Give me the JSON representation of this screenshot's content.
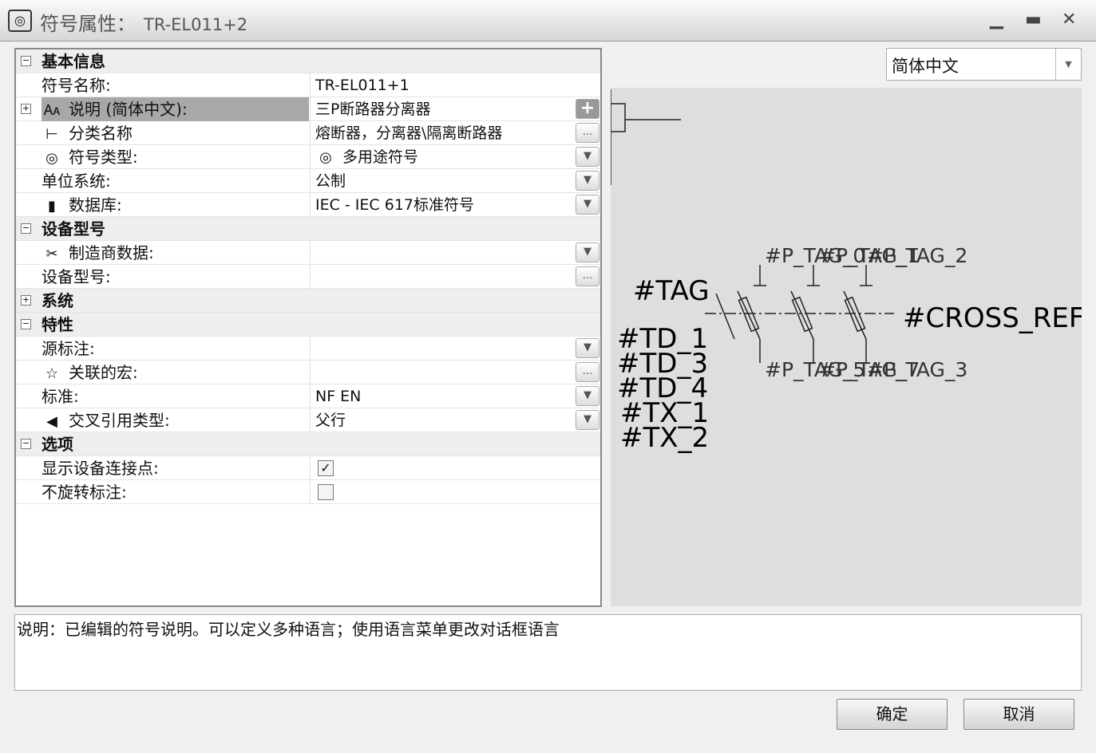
{
  "window": {
    "title": "符号属性：",
    "symbol_id": "TR-EL011+2",
    "icon": "symbol-icon",
    "minimize": "▁",
    "maximize": "▬",
    "close": "✕"
  },
  "grid": {
    "rows": [
      {
        "type": "section",
        "expanded": true,
        "label": "基本信息"
      },
      {
        "label": "符号名称:",
        "value": "TR-EL011+1"
      },
      {
        "label": "说明 (简体中文):",
        "value": "三P断路器分离器",
        "icon": "translate-icon",
        "expander": "+",
        "button": "plus",
        "selected": true
      },
      {
        "label": "分类名称",
        "value": "熔断器，分离器\\隔离断路器",
        "icon": "tree-icon",
        "button": "ellipsis"
      },
      {
        "label": "符号类型:",
        "value": "多用途符号",
        "icon": "symbol-icon",
        "value_icon": "symbol-icon",
        "button": "dropdown"
      },
      {
        "label": "单位系统:",
        "value": "公制",
        "button": "dropdown"
      },
      {
        "label": "数据库:",
        "value": "IEC - IEC 617标准符号",
        "icon": "database-icon",
        "button": "dropdown"
      },
      {
        "type": "section",
        "expanded": true,
        "label": "设备型号"
      },
      {
        "label": "制造商数据:",
        "value": "",
        "icon": "tools-icon",
        "button": "dropdown"
      },
      {
        "label": "设备型号:",
        "value": "",
        "button": "ellipsis"
      },
      {
        "type": "section",
        "expanded": false,
        "label": "系统"
      },
      {
        "type": "section",
        "expanded": true,
        "label": "特性"
      },
      {
        "label": "源标注:",
        "value": "",
        "button": "dropdown"
      },
      {
        "label": "关联的宏:",
        "value": "",
        "icon": "star-icon",
        "button": "ellipsis"
      },
      {
        "label": "标准:",
        "value": "NF EN",
        "button": "dropdown"
      },
      {
        "label": "交叉引用类型:",
        "value": "父行",
        "icon": "cross-ref-icon",
        "button": "dropdown"
      },
      {
        "type": "section",
        "expanded": true,
        "label": "选项"
      },
      {
        "label": "显示设备连接点:",
        "checkbox": true,
        "checked": true
      },
      {
        "label": "不旋转标注:",
        "checkbox": true,
        "checked": false
      }
    ]
  },
  "language": {
    "selected": "简体中文"
  },
  "preview": {
    "tag": "#TAG",
    "cross_ref": "#CROSS_REF",
    "top_labels": [
      "#P_TAG_0",
      "#P_TAG_1",
      "#P_TAG_2"
    ],
    "bottom_labels": [
      "#P_TAG_5",
      "#P_TAG_7",
      "#P_TAG_3"
    ],
    "left_labels": [
      "#TD_1",
      "#TD_3",
      "#TD_4",
      "#TX_1",
      "#TX_2"
    ]
  },
  "description": "说明：已编辑的符号说明。可以定义多种语言；使用语言菜单更改对话框语言",
  "buttons": {
    "ok": "确定",
    "cancel": "取消"
  }
}
